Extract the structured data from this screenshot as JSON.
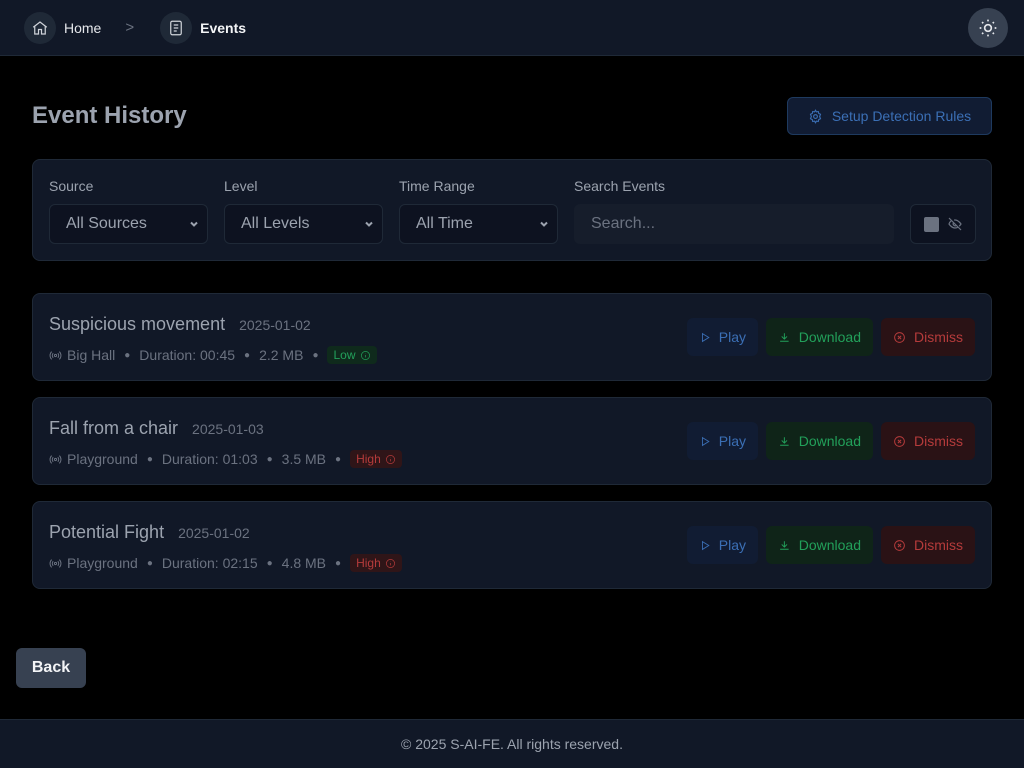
{
  "breadcrumb": {
    "home_label": "Home",
    "separator": ">",
    "current_label": "Events"
  },
  "page": {
    "title": "Event History",
    "setup_button": "Setup Detection Rules"
  },
  "filters": {
    "source": {
      "label": "Source",
      "value": "All Sources"
    },
    "level": {
      "label": "Level",
      "value": "All Levels"
    },
    "time_range": {
      "label": "Time Range",
      "value": "All Time"
    },
    "search": {
      "label": "Search Events",
      "placeholder": "Search..."
    }
  },
  "events": [
    {
      "title": "Suspicious movement",
      "date": "2025-01-02",
      "source": "Big Hall",
      "duration": "Duration: 00:45",
      "size": "2.2 MB",
      "level": "Low",
      "play": "Play",
      "download": "Download",
      "dismiss": "Dismiss"
    },
    {
      "title": "Fall from a chair",
      "date": "2025-01-03",
      "source": "Playground",
      "duration": "Duration: 01:03",
      "size": "3.5 MB",
      "level": "High",
      "play": "Play",
      "download": "Download",
      "dismiss": "Dismiss"
    },
    {
      "title": "Potential Fight",
      "date": "2025-01-02",
      "source": "Playground",
      "duration": "Duration: 02:15",
      "size": "4.8 MB",
      "level": "High",
      "play": "Play",
      "download": "Download",
      "dismiss": "Dismiss"
    }
  ],
  "back_button": "Back",
  "footer": "© 2025 S-AI-FE. All rights reserved.",
  "icons": {
    "home": "home-icon",
    "events": "document-icon",
    "theme": "sun-icon",
    "settings": "gear-icon",
    "hide": "eye-off-icon",
    "source": "broadcast-icon",
    "play": "play-icon",
    "download": "download-icon",
    "dismiss": "x-circle-icon",
    "info": "info-icon"
  },
  "colors": {
    "primary": "#3b6fb5",
    "success": "#22a05a",
    "danger": "#b53b3b"
  }
}
